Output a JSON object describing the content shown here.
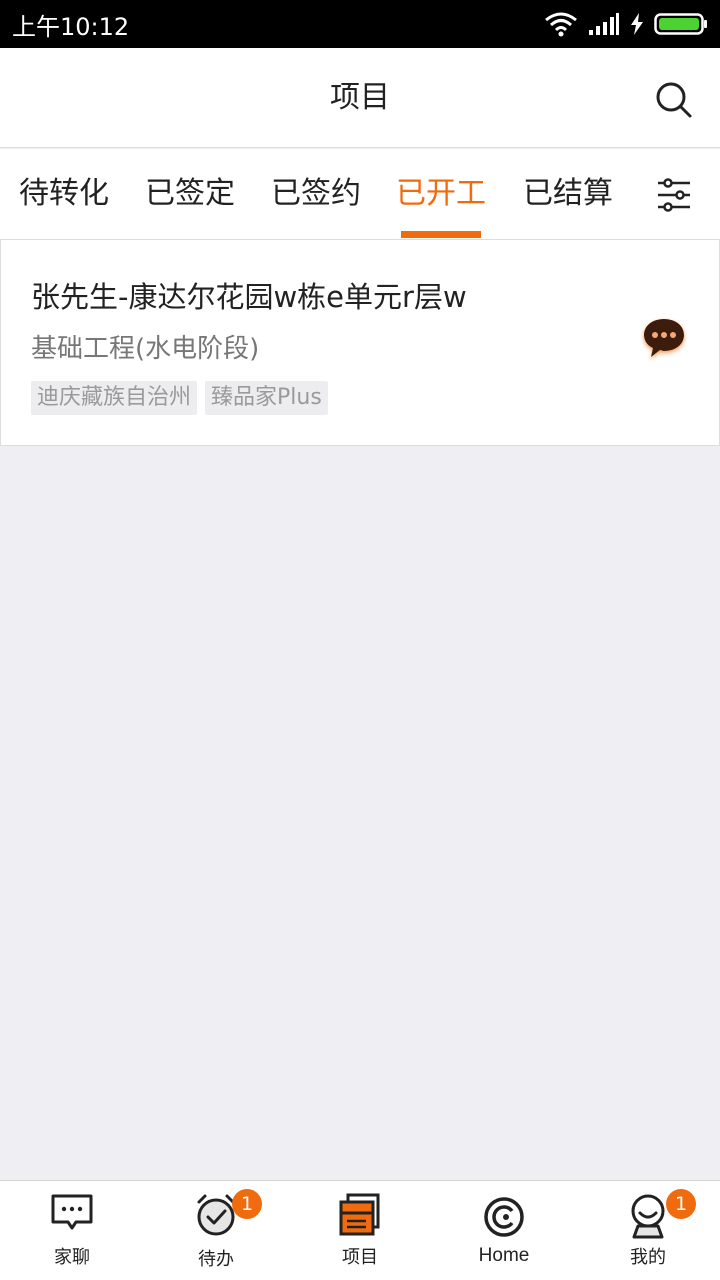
{
  "status_bar": {
    "time": "上午10:12"
  },
  "header": {
    "title": "项目",
    "search_icon": "search-icon"
  },
  "tabs": [
    {
      "label": "待转化",
      "active": false
    },
    {
      "label": "已签定",
      "active": false
    },
    {
      "label": "已签约",
      "active": false
    },
    {
      "label": "已开工",
      "active": true
    },
    {
      "label": "已结算",
      "active": false
    }
  ],
  "filter_icon": "filter-sliders-icon",
  "project": {
    "title": "张先生-康达尔花园w栋e单元r层w",
    "stage": "基础工程(水电阶段)",
    "tags": [
      "迪庆藏族自治州",
      "臻品家Plus"
    ],
    "chat_icon": "chat-bubble-icon"
  },
  "bottom_nav": [
    {
      "label": "家聊",
      "icon": "chat-icon",
      "badge": ""
    },
    {
      "label": "待办",
      "icon": "alarm-clock-icon",
      "badge": "1"
    },
    {
      "label": "项目",
      "icon": "project-stack-icon",
      "badge": ""
    },
    {
      "label": "Home",
      "icon": "home-circle-icon",
      "badge": ""
    },
    {
      "label": "我的",
      "icon": "profile-icon",
      "badge": "1"
    }
  ],
  "colors": {
    "accent": "#f06a0e",
    "background": "#eeeef3"
  }
}
